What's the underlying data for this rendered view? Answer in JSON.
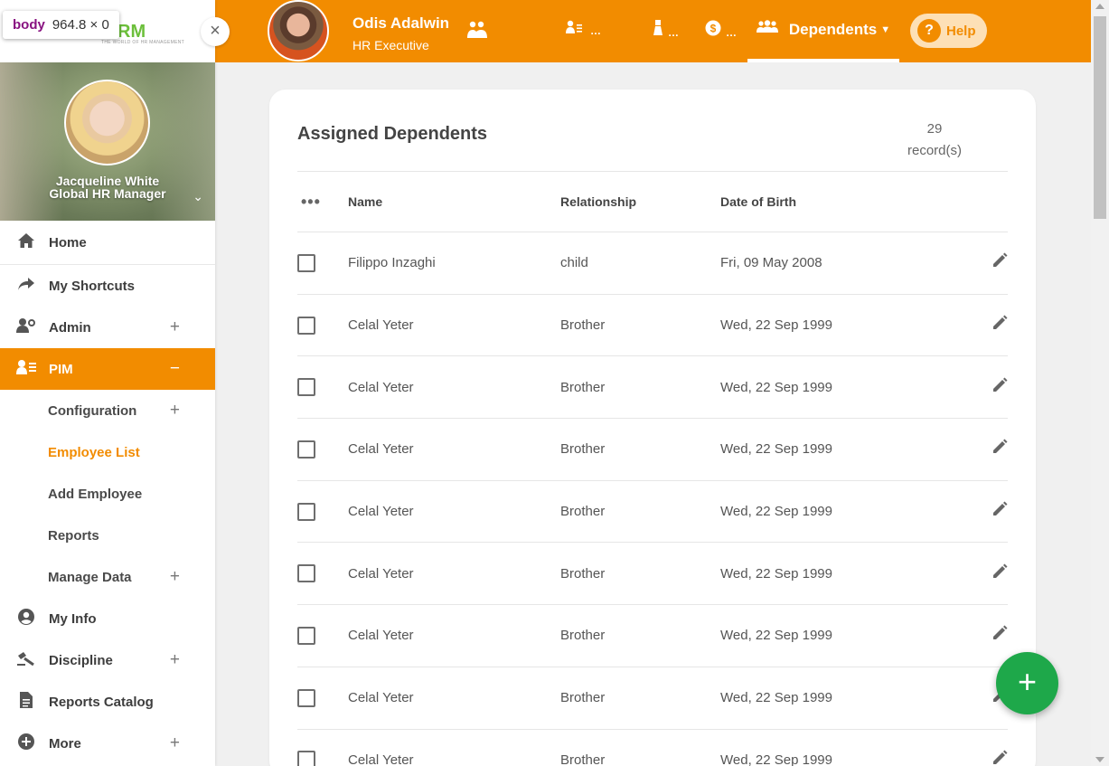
{
  "inspector": {
    "tag": "body",
    "dims": "964.8 × 0"
  },
  "logo": {
    "text": "RM",
    "subtitle": "THE WORLD OF HR MANAGEMENT"
  },
  "profile": {
    "name": "Jacqueline White",
    "role": "Global HR Manager"
  },
  "sidebar": {
    "items": [
      {
        "label": "Home",
        "icon": "home-icon"
      },
      {
        "label": "My Shortcuts",
        "icon": "share-arrow-icon"
      },
      {
        "label": "Admin",
        "icon": "admin-gear-icon"
      },
      {
        "label": "PIM",
        "icon": "pim-icon"
      },
      {
        "label": "My Info",
        "icon": "user-circle-icon"
      },
      {
        "label": "Discipline",
        "icon": "discipline-icon"
      },
      {
        "label": "Reports Catalog",
        "icon": "document-icon"
      },
      {
        "label": "More",
        "icon": "plus-circle-icon"
      }
    ],
    "pim_sub": [
      {
        "label": "Configuration"
      },
      {
        "label": "Employee List"
      },
      {
        "label": "Add Employee"
      },
      {
        "label": "Reports"
      },
      {
        "label": "Manage Data"
      }
    ]
  },
  "topbar": {
    "user_name": "Odis Adalwin",
    "user_role": "HR Executive",
    "tabs": [
      {
        "label": "…",
        "icon": "employee-list-icon"
      },
      {
        "label": "…",
        "icon": "award-icon"
      },
      {
        "label": "…",
        "icon": "salary-icon"
      }
    ],
    "active_tab": "Dependents",
    "help": "Help"
  },
  "card": {
    "title": "Assigned Dependents",
    "count": "29",
    "count_label": "record(s)",
    "columns": {
      "name": "Name",
      "relationship": "Relationship",
      "dob": "Date of Birth"
    },
    "rows": [
      {
        "name": "Filippo Inzaghi",
        "relationship": "child",
        "dob": "Fri, 09 May 2008"
      },
      {
        "name": "Celal Yeter",
        "relationship": "Brother",
        "dob": "Wed, 22 Sep 1999"
      },
      {
        "name": "Celal Yeter",
        "relationship": "Brother",
        "dob": "Wed, 22 Sep 1999"
      },
      {
        "name": "Celal Yeter",
        "relationship": "Brother",
        "dob": "Wed, 22 Sep 1999"
      },
      {
        "name": "Celal Yeter",
        "relationship": "Brother",
        "dob": "Wed, 22 Sep 1999"
      },
      {
        "name": "Celal Yeter",
        "relationship": "Brother",
        "dob": "Wed, 22 Sep 1999"
      },
      {
        "name": "Celal Yeter",
        "relationship": "Brother",
        "dob": "Wed, 22 Sep 1999"
      },
      {
        "name": "Celal Yeter",
        "relationship": "Brother",
        "dob": "Wed, 22 Sep 1999"
      },
      {
        "name": "Celal Yeter",
        "relationship": "Brother",
        "dob": "Wed, 22 Sep 1999"
      }
    ]
  },
  "colors": {
    "accent": "#f28c00",
    "fab": "#1ea84a"
  }
}
